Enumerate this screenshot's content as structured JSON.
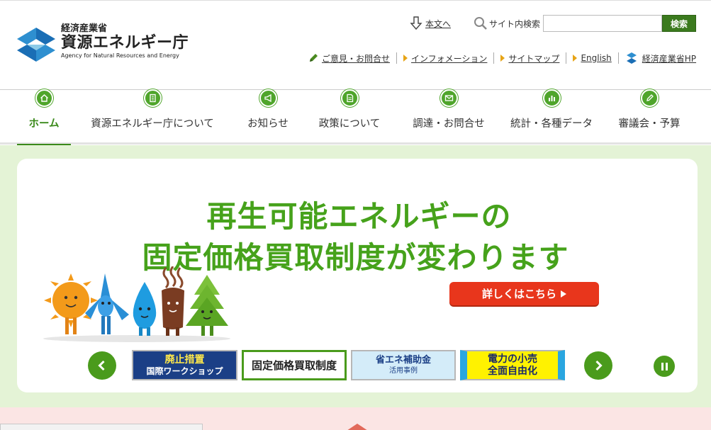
{
  "header": {
    "logo": {
      "small": "経済産業省",
      "big": "資源エネルギー庁",
      "en": "Agency for Natural Resources and Energy"
    },
    "skip_link": "本文へ",
    "search": {
      "label": "サイト内検索",
      "value": "",
      "button": "検索"
    },
    "utility": [
      {
        "label": "ご意見・お問合せ",
        "icon": "pen-icon"
      },
      {
        "label": "インフォメーション",
        "icon": "triangle-icon"
      },
      {
        "label": "サイトマップ",
        "icon": "triangle-icon"
      },
      {
        "label": "English",
        "icon": "triangle-icon"
      },
      {
        "label": "経済産業省HP",
        "icon": "meti-logo-icon"
      }
    ]
  },
  "gnav": [
    {
      "label": "ホーム",
      "icon": "home-icon",
      "active": true
    },
    {
      "label": "資源エネルギー庁について",
      "icon": "building-icon",
      "active": false
    },
    {
      "label": "お知らせ",
      "icon": "megaphone-icon",
      "active": false
    },
    {
      "label": "政策について",
      "icon": "document-icon",
      "active": false
    },
    {
      "label": "調達・お問合せ",
      "icon": "envelope-icon",
      "active": false
    },
    {
      "label": "統計・各種データ",
      "icon": "bar-chart-icon",
      "active": false
    },
    {
      "label": "審議会・予算",
      "icon": "pencil-icon",
      "active": false
    }
  ],
  "hero": {
    "title_line1": "再生可能エネルギーの",
    "title_line2": "固定価格買取制度が変わります",
    "button": "詳しくはこちら"
  },
  "carousel": {
    "items": [
      {
        "line1": "廃止措置",
        "line2": "国際ワークショップ"
      },
      {
        "line1": "固定価格買取制度",
        "line2": ""
      },
      {
        "line1": "省エネ補助金",
        "line2": "活用事例"
      },
      {
        "line1": "電力の小売",
        "line2": "全面自由化"
      }
    ]
  },
  "colors": {
    "accent": "#4a9b1c",
    "hero_bg": "#e4f3d6",
    "cta": "#e8361c"
  }
}
